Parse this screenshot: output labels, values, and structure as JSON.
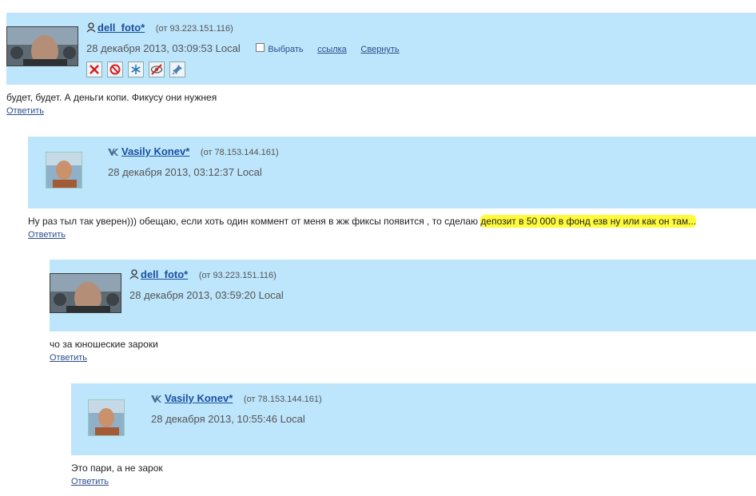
{
  "comments": [
    {
      "username": "dell_foto*",
      "ip": "(от 93.223.151.116)",
      "date": "28 декабря 2013, 03:09:53 Local",
      "select_label": "Выбрать",
      "link_label": "ссылка",
      "collapse_label": "Свернуть",
      "text": "будет, будет. А деньги копи. Фикусу они нужнея",
      "reply_label": "Ответить"
    },
    {
      "username": "Vasily Konev*",
      "ip": "(от 78.153.144.161)",
      "date": "28 декабря 2013, 03:12:37 Local",
      "text_before": "Ну раз тыл так уверен))) обещаю, если хоть один коммент от меня в жж фиксы появится , то сделаю ",
      "text_highlight": "депозит в 50 000 в фонд езв ну или как он там...",
      "reply_label": "Ответить"
    },
    {
      "username": "dell_foto*",
      "ip": "(от 93.223.151.116)",
      "date": "28 декабря 2013, 03:59:20 Local",
      "text": "чо за юношеские зароки",
      "reply_label": "Ответить"
    },
    {
      "username": "Vasily Konev*",
      "ip": "(от 78.153.144.161)",
      "date": "28 декабря 2013, 10:55:46 Local",
      "text": "Это пари, а не зарок",
      "reply_label": "Ответить"
    }
  ],
  "tools": [
    "delete-icon",
    "ban-icon",
    "freeze-icon",
    "unscreen-icon",
    "pin-icon"
  ],
  "colors": {
    "header_bg": "#bde5fb",
    "link": "#1a4fa0",
    "highlight": "#fffb3a"
  }
}
